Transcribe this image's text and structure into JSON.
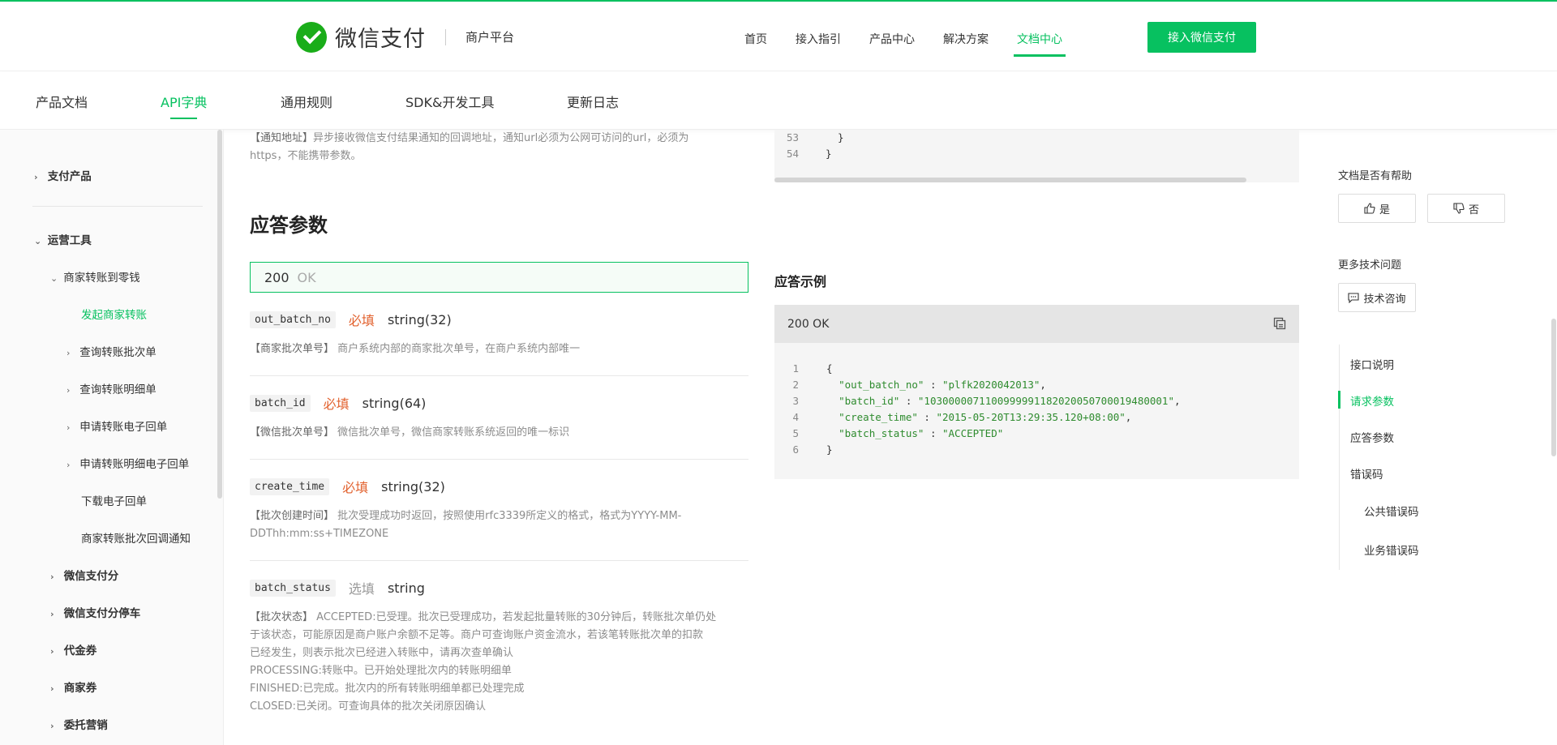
{
  "brand": {
    "name": "微信支付",
    "sub": "商户平台"
  },
  "topnav": {
    "items": [
      "首页",
      "接入指引",
      "产品中心",
      "解决方案",
      "文档中心"
    ],
    "active_index": 4,
    "cta": "接入微信支付"
  },
  "subnav": {
    "items": [
      "产品文档",
      "API字典",
      "通用规则",
      "SDK&开发工具",
      "更新日志"
    ],
    "active_index": 1
  },
  "sidebar": {
    "items": [
      {
        "label": "支付产品"
      },
      {
        "label": "运营工具"
      },
      {
        "label": "商家转账到零钱"
      },
      {
        "label": "发起商家转账"
      },
      {
        "label": "查询转账批次单"
      },
      {
        "label": "查询转账明细单"
      },
      {
        "label": "申请转账电子回单"
      },
      {
        "label": "申请转账明细电子回单"
      },
      {
        "label": "下载电子回单"
      },
      {
        "label": "商家转账批次回调通知"
      },
      {
        "label": "微信支付分"
      },
      {
        "label": "微信支付分停车"
      },
      {
        "label": "代金券"
      },
      {
        "label": "商家券"
      },
      {
        "label": "委托营销"
      }
    ]
  },
  "notify": {
    "label": "【通知地址】",
    "line1": "异步接收微信支付结果通知的回调地址，通知url必须为公网可访问的url，必须为",
    "line2": "https，不能携带参数。"
  },
  "response": {
    "title": "应答参数",
    "status_code": "200",
    "status_text": "OK",
    "params": [
      {
        "name": "out_batch_no",
        "req": "必填",
        "type": "string(32)",
        "label": "【商家批次单号】",
        "desc": [
          "商户系统内部的商家批次单号，在商户系统内部唯一"
        ]
      },
      {
        "name": "batch_id",
        "req": "必填",
        "type": "string(64)",
        "label": "【微信批次单号】",
        "desc": [
          "微信批次单号，微信商家转账系统返回的唯一标识"
        ]
      },
      {
        "name": "create_time",
        "req": "必填",
        "type": "string(32)",
        "label": "【批次创建时间】",
        "desc": [
          "批次受理成功时返回，按照使用rfc3339所定义的格式，格式为YYYY-MM-",
          "DDThh:mm:ss+TIMEZONE"
        ]
      },
      {
        "name": "batch_status",
        "req": "选填",
        "type": "string",
        "label": "【批次状态】",
        "desc": [
          "ACCEPTED:已受理。批次已受理成功，若发起批量转账的30分钟后，转账批次单仍处",
          "于该状态，可能原因是商户账户余额不足等。商户可查询账户资金流水，若该笔转账批次单的扣款",
          "已经发生，则表示批次已经进入转账中，请再次查单确认",
          "PROCESSING:转账中。已开始处理批次内的转账明细单",
          "FINISHED:已完成。批次内的所有转账明细单都已处理完成",
          "CLOSED:已关闭。可查询具体的批次关闭原因确认"
        ]
      }
    ]
  },
  "request_code_tail": {
    "lines": [
      {
        "n": "53",
        "code": "  }"
      },
      {
        "n": "54",
        "code": "}"
      }
    ]
  },
  "example": {
    "title": "应答示例",
    "head": "200 OK",
    "lines": [
      {
        "n": "1",
        "pre": "{",
        "key": "",
        "mid": "",
        "val": "",
        "post": ""
      },
      {
        "n": "2",
        "pre": "  ",
        "key": "\"out_batch_no\"",
        "mid": " : ",
        "val": "\"plfk2020042013\"",
        "post": ","
      },
      {
        "n": "3",
        "pre": "  ",
        "key": "\"batch_id\"",
        "mid": " : ",
        "val": "\"1030000071100999991182020050700019480001\"",
        "post": ","
      },
      {
        "n": "4",
        "pre": "  ",
        "key": "\"create_time\"",
        "mid": " : ",
        "val": "\"2015-05-20T13:29:35.120+08:00\"",
        "post": ","
      },
      {
        "n": "5",
        "pre": "  ",
        "key": "\"batch_status\"",
        "mid": " : ",
        "val": "\"ACCEPTED\"",
        "post": ""
      },
      {
        "n": "6",
        "pre": "}",
        "key": "",
        "mid": "",
        "val": "",
        "post": ""
      }
    ]
  },
  "help": {
    "title": "文档是否有帮助",
    "yes": "是",
    "no": "否",
    "more": "更多技术问题",
    "consult": "技术咨询"
  },
  "toc": {
    "items": [
      "接口说明",
      "请求参数",
      "应答参数",
      "错误码",
      "公共错误码",
      "业务错误码"
    ],
    "active_index": 1
  },
  "colors": {
    "brand": "#07c160",
    "required": "#e2622f"
  }
}
